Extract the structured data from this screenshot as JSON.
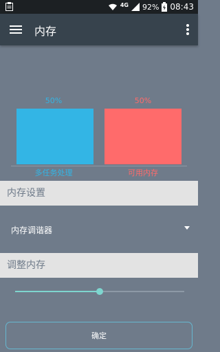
{
  "status_bar": {
    "network": "4G",
    "battery": "92%",
    "time": "08:43",
    "icons": [
      "clipboard-icon",
      "wifi-icon",
      "signal-icon",
      "battery-icon"
    ]
  },
  "app_bar": {
    "title": "内存",
    "icons": [
      "menu-icon",
      "more-vert-icon"
    ]
  },
  "colors": {
    "background": "#6f7b8a",
    "app_bar": "#37434d",
    "multitask": "#33b5e5",
    "available": "#ff6b6b",
    "accent": "#7ed6cf"
  },
  "chart_data": {
    "type": "bar",
    "categories": [
      "多任务处理",
      "可用内存"
    ],
    "values": [
      50,
      50
    ],
    "value_labels": [
      "50%",
      "50%"
    ],
    "colors": [
      "#33b5e5",
      "#ff6b6b"
    ],
    "ylim": [
      0,
      50
    ]
  },
  "memory_settings": {
    "header": "内存设置",
    "selected": "内存调谐器"
  },
  "adjust_memory": {
    "header": "调整内存",
    "slider_value": 0.5
  },
  "confirm_button": {
    "label": "确定"
  }
}
